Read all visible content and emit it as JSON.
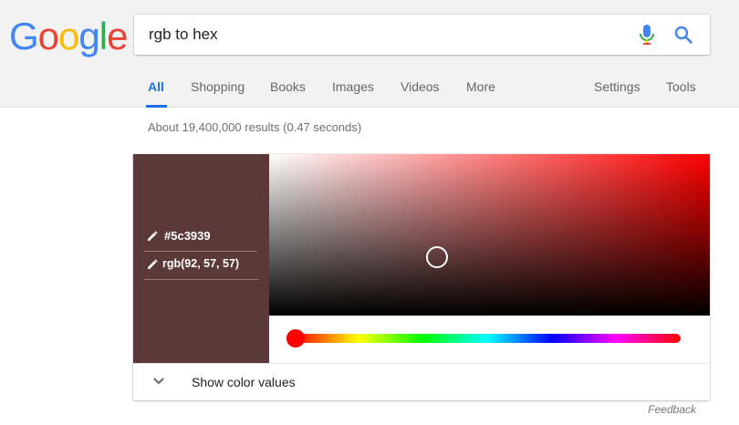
{
  "logo": {
    "letters": [
      {
        "char": "G",
        "color": "#4285f4"
      },
      {
        "char": "o",
        "color": "#ea4335"
      },
      {
        "char": "o",
        "color": "#fbbc05"
      },
      {
        "char": "g",
        "color": "#4285f4"
      },
      {
        "char": "l",
        "color": "#34a853"
      },
      {
        "char": "e",
        "color": "#ea4335"
      }
    ]
  },
  "search": {
    "query": "rgb to hex"
  },
  "tabs": {
    "all": "All",
    "shopping": "Shopping",
    "books": "Books",
    "images": "Images",
    "videos": "Videos",
    "more": "More",
    "settings": "Settings",
    "tools": "Tools"
  },
  "result_stats": "About 19,400,000 results (0.47 seconds)",
  "color_picker": {
    "hex": "#5c3939",
    "rgb": "rgb(92, 57, 57)",
    "hue_color": "#ff0000",
    "hue_fraction": 0,
    "saturation": 0.38,
    "value": 0.36,
    "show_values_label": "Show color values"
  },
  "feedback_label": "Feedback"
}
